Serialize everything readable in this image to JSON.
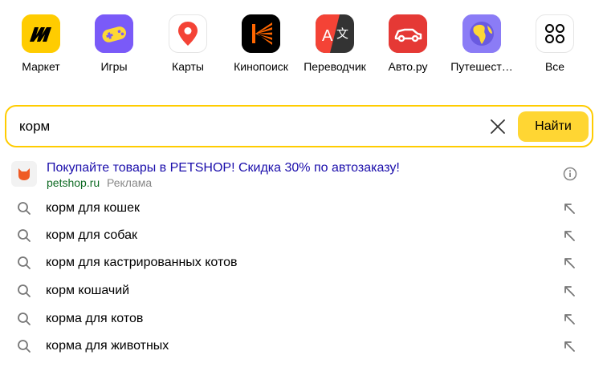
{
  "services": [
    {
      "label": "Маркет",
      "icon": "market-icon"
    },
    {
      "label": "Игры",
      "icon": "gamepad-icon"
    },
    {
      "label": "Карты",
      "icon": "map-pin-icon"
    },
    {
      "label": "Кинопоиск",
      "icon": "kinopoisk-icon"
    },
    {
      "label": "Переводчик",
      "icon": "translate-icon"
    },
    {
      "label": "Авто.ру",
      "icon": "car-icon"
    },
    {
      "label": "Путешест…",
      "icon": "globe-icon"
    },
    {
      "label": "Все",
      "icon": "grid-icon"
    }
  ],
  "search": {
    "value": "корм",
    "button_label": "Найти",
    "border_color": "#ffcc00",
    "button_color": "#ffd633"
  },
  "ad": {
    "title": "Покупайте товары в PETSHOP! Скидка 30% по автозаказу!",
    "domain": "petshop.ru",
    "label": "Реклама",
    "icon": "petshop-cat-icon"
  },
  "suggestions": [
    "корм для кошек",
    "корм для собак",
    "корм для кастрированных котов",
    "корм кошачий",
    "корма для котов",
    "корма для животных"
  ]
}
